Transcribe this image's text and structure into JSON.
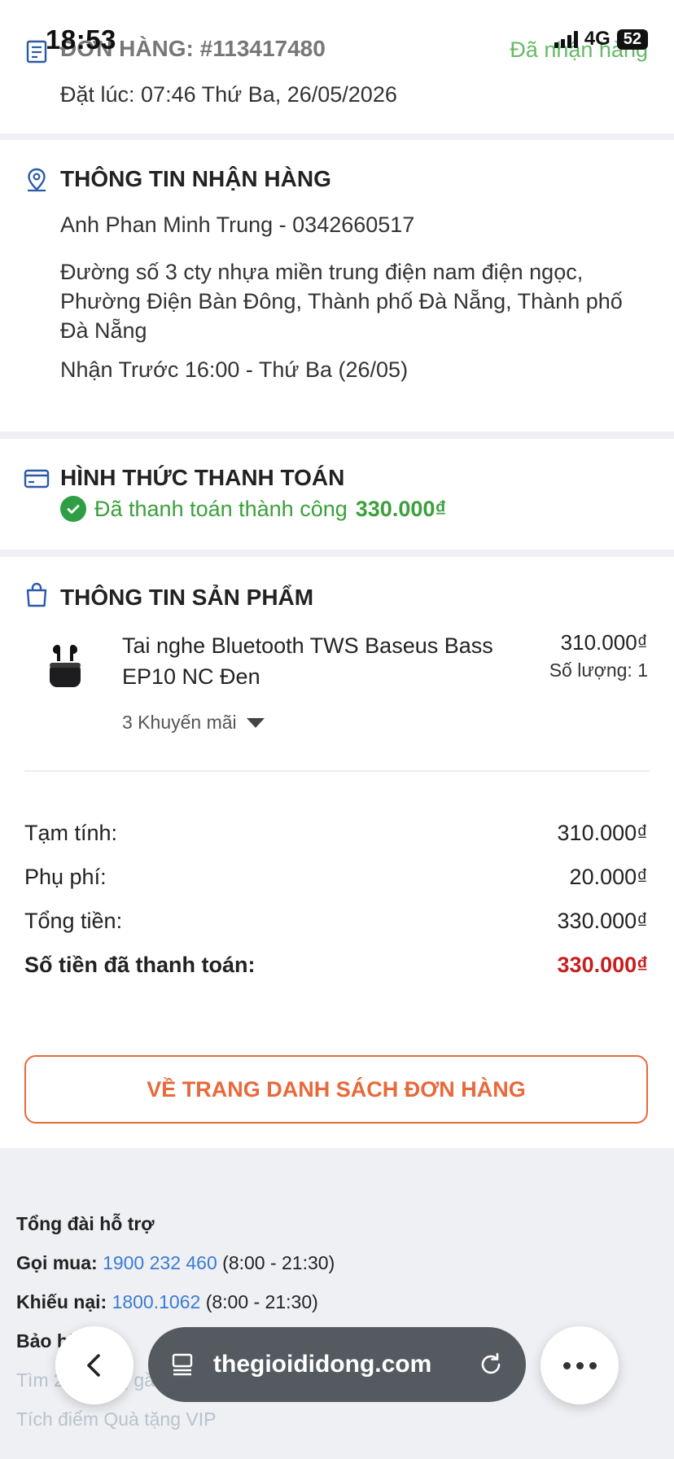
{
  "status_bar": {
    "time": "18:53",
    "network": "4G",
    "battery": "52"
  },
  "order": {
    "title": "ĐƠN HÀNG: #113417480",
    "status": "Đã nhận hàng",
    "date": "Đặt lúc: 07:46 Thứ Ba, 26/05/2026"
  },
  "shipping": {
    "title": "THÔNG TIN NHẬN HÀNG",
    "recipient": "Anh Phan Minh Trung - 0342660517",
    "address": "Đường số 3 cty nhựa miền trung điện nam điện ngọc, Phường Điện Bàn Đông, Thành phố Đà Nẵng, Thành phố Đà Nẵng",
    "delivery_time": "Nhận Trước 16:00 - Thứ Ba (26/05)"
  },
  "payment": {
    "title": "HÌNH THỨC THANH TOÁN",
    "status_text": "Đã thanh toán thành công",
    "amount": "330.000₫"
  },
  "product_section": {
    "title": "THÔNG TIN SẢN PHẨM",
    "item": {
      "name": "Tai nghe Bluetooth TWS Baseus Bass EP10 NC Đen",
      "price": "310.000₫",
      "quantity": "Số lượng: 1",
      "promotions": "3 Khuyến mãi",
      "image_icon": "earbuds-icon"
    }
  },
  "summary": {
    "subtotal_label": "Tạm tính:",
    "subtotal": "310.000₫",
    "fee_label": "Phụ phí:",
    "fee": "20.000₫",
    "total_label": "Tổng tiền:",
    "total": "330.000₫",
    "paid_label": "Số tiền đã thanh toán:",
    "paid": "330.000₫"
  },
  "back_button": "VỀ TRANG DANH SÁCH ĐƠN HÀNG",
  "footer": {
    "heading": "Tổng đài hỗ trợ",
    "buy_label": "Gọi mua:",
    "buy_phone": "1900 232 460",
    "buy_hours": "(8:00 - 21:30)",
    "complaint_label": "Khiếu nại:",
    "complaint_phone": "1800.1062",
    "complaint_hours": "(8:00 - 21:30)",
    "warranty_label": "Bảo hành:",
    "link_1": "Tìm 2 siêu thị gần nhất",
    "link_2": "Tích điểm Quà tặng VIP"
  },
  "browser": {
    "url": "thegioididong.com"
  },
  "colors": {
    "accent_orange": "#e8693a",
    "success_green": "#3ba03b",
    "paid_red": "#c81e1e",
    "link_blue": "#3a7bd5"
  }
}
